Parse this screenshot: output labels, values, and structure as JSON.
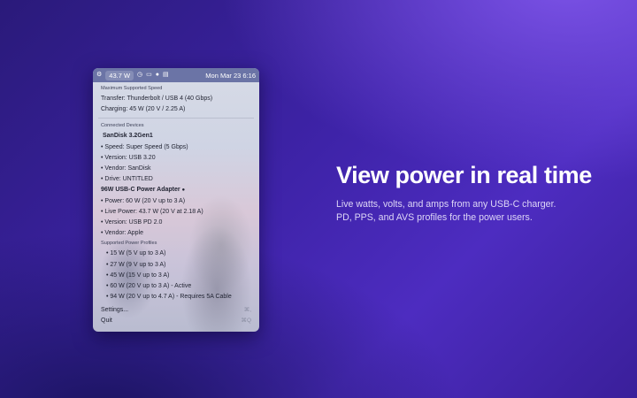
{
  "menubar": {
    "power": "43.7 W",
    "datetime": "Mon Mar 23  6:16",
    "icons": [
      "settings-icon",
      "clock-icon",
      "battery-icon",
      "record-icon",
      "control-center-icon"
    ]
  },
  "menu": {
    "max_speed_header": "Maximum Supported Speed",
    "transfer": "Transfer: Thunderbolt / USB 4 (40 Gbps)",
    "charging": "Charging: 45 W (20 V / 2.25 A)",
    "devices_header": "Connected Devices",
    "device1": {
      "name": "SanDisk 3.2Gen1",
      "details": [
        "• Speed: Super Speed (5 Gbps)",
        "• Version: USB 3.20",
        "• Vendor: SanDisk",
        "• Drive: UNTITLED"
      ]
    },
    "device2": {
      "name": "96W USB-C Power Adapter",
      "details": [
        "• Power: 60 W (20 V up to 3 A)",
        "• Live Power: 43.7 W (20 V at 2.18 A)",
        "• Version: USB PD 2.0",
        "• Vendor: Apple"
      ]
    },
    "profiles_header": "Supported Power Profiles",
    "profiles": [
      "• 15 W (5 V up to 3 A)",
      "• 27 W (9 V up to 3 A)",
      "• 45 W (15 V up to 3 A)",
      "• 60 W (20 V up to 3 A) - Active",
      "• 94 W (20 V up to 4.7 A) - Requires 5A Cable"
    ],
    "settings_label": "Settings...",
    "settings_shortcut": "⌘,",
    "quit_label": "Quit",
    "quit_shortcut": "⌘Q"
  },
  "promo": {
    "headline": "View power in real time",
    "subtext": "Live watts, volts, and amps from any USB-C charger. PD, PPS, and AVS profiles for the power users."
  }
}
